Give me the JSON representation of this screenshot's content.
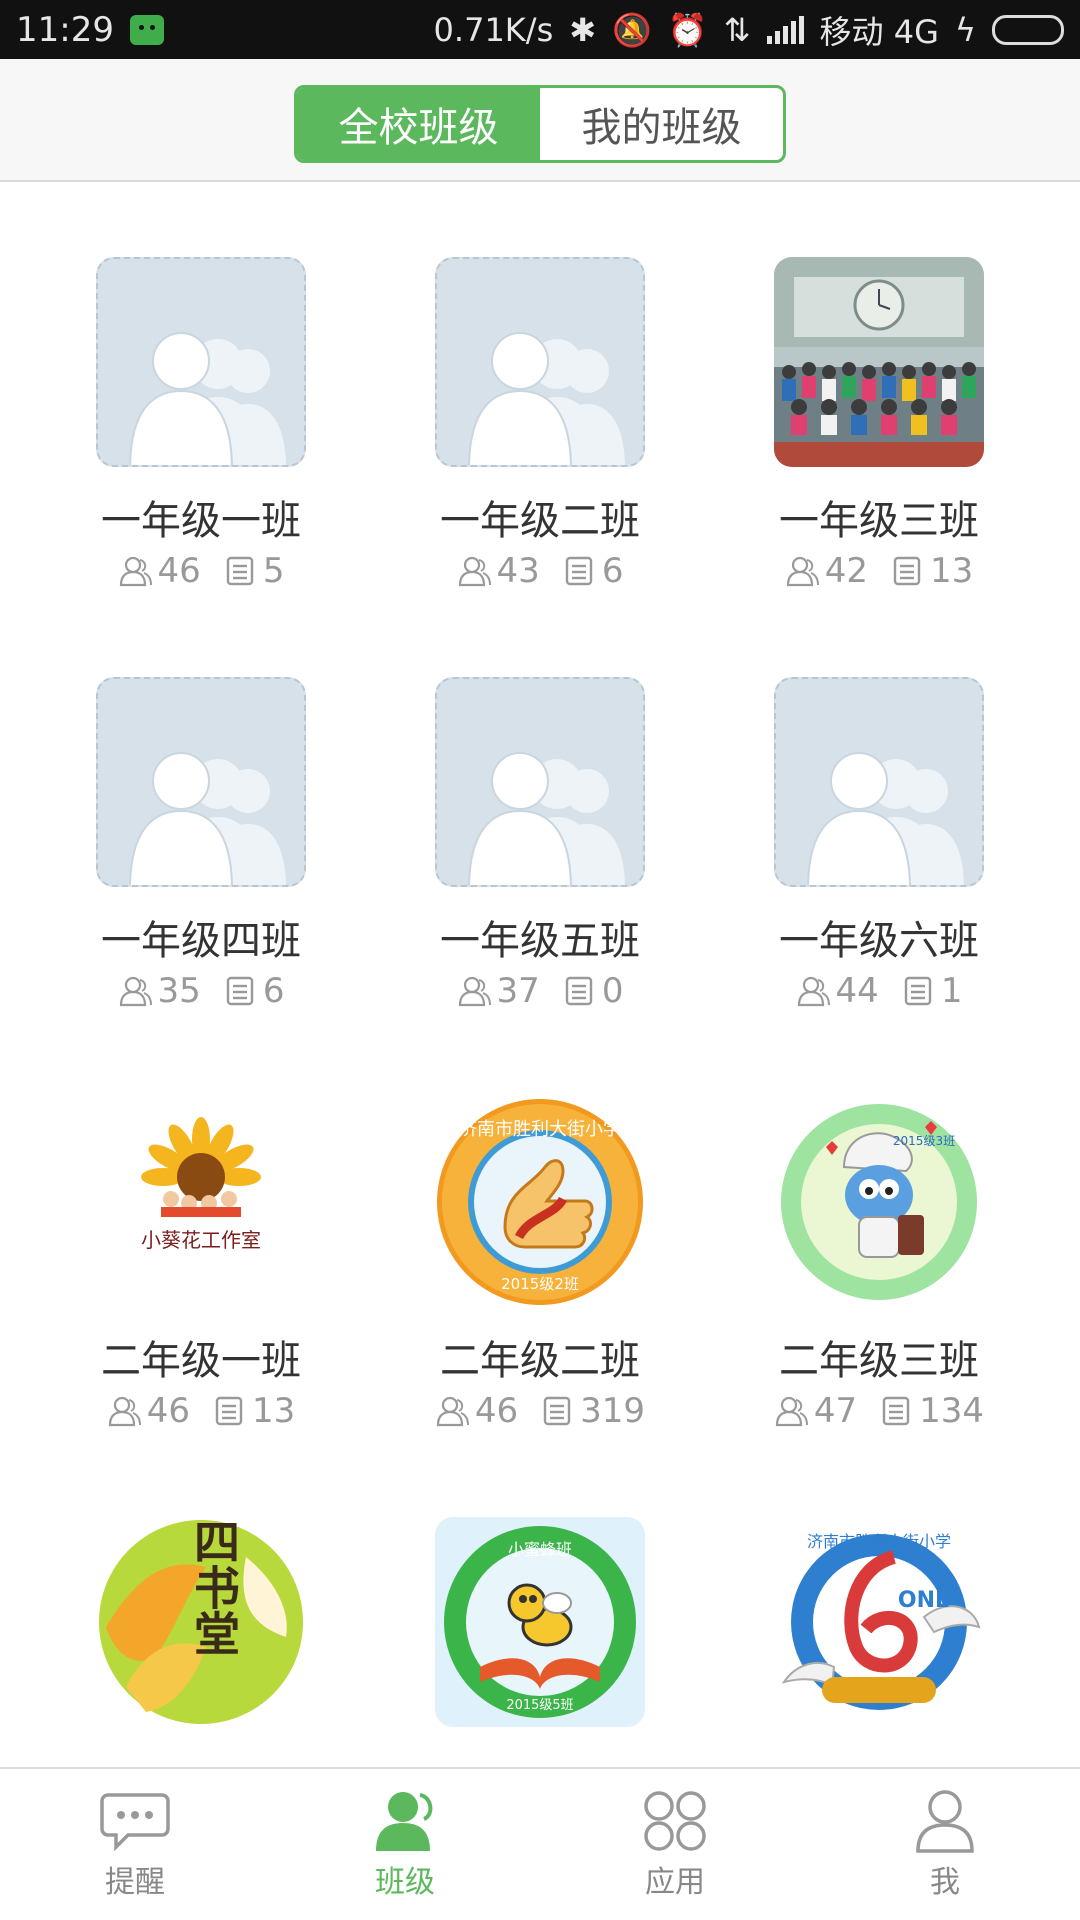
{
  "status_bar": {
    "time": "11:29",
    "net_speed": "0.71K/s",
    "carrier": "移动 4G"
  },
  "segment": {
    "tabs": [
      {
        "label": "全校班级",
        "active": true
      },
      {
        "label": "我的班级",
        "active": false
      }
    ]
  },
  "classes": [
    {
      "name": "一年级一班",
      "members": "46",
      "posts": "5",
      "avatar": "default"
    },
    {
      "name": "一年级二班",
      "members": "43",
      "posts": "6",
      "avatar": "default"
    },
    {
      "name": "一年级三班",
      "members": "42",
      "posts": "13",
      "avatar": "class-photo"
    },
    {
      "name": "一年级四班",
      "members": "35",
      "posts": "6",
      "avatar": "default"
    },
    {
      "name": "一年级五班",
      "members": "37",
      "posts": "0",
      "avatar": "default"
    },
    {
      "name": "一年级六班",
      "members": "44",
      "posts": "1",
      "avatar": "default"
    },
    {
      "name": "二年级一班",
      "members": "46",
      "posts": "13",
      "avatar": "sunflower-logo",
      "logo_text": "小葵花工作室"
    },
    {
      "name": "二年级二班",
      "members": "46",
      "posts": "319",
      "avatar": "thumb-badge",
      "logo_text": "济南市胜利大街小学",
      "logo_sub": "2015级2班"
    },
    {
      "name": "二年级三班",
      "members": "47",
      "posts": "134",
      "avatar": "smurf-badge",
      "logo_sub": "2015级3班"
    },
    {
      "name": "",
      "members": "",
      "posts": "",
      "avatar": "sishutang-badge",
      "logo_text": "四书堂"
    },
    {
      "name": "",
      "members": "",
      "posts": "",
      "avatar": "bee-badge",
      "logo_text": "小蜜蜂班",
      "logo_sub": "2015级5班"
    },
    {
      "name": "",
      "members": "",
      "posts": "",
      "avatar": "six-one-badge",
      "logo_text": "济南市胜利大街小学",
      "logo_sub": "ONE"
    }
  ],
  "colors": {
    "accent": "#5cb85c",
    "default_avatar_bg": "#d6e1ea"
  },
  "tabbar": {
    "items": [
      {
        "label": "提醒",
        "icon": "chat-bubble-icon",
        "active": false
      },
      {
        "label": "班级",
        "icon": "person-icon",
        "active": true
      },
      {
        "label": "应用",
        "icon": "apps-grid-icon",
        "active": false
      },
      {
        "label": "我",
        "icon": "person-outline-icon",
        "active": false
      }
    ]
  }
}
